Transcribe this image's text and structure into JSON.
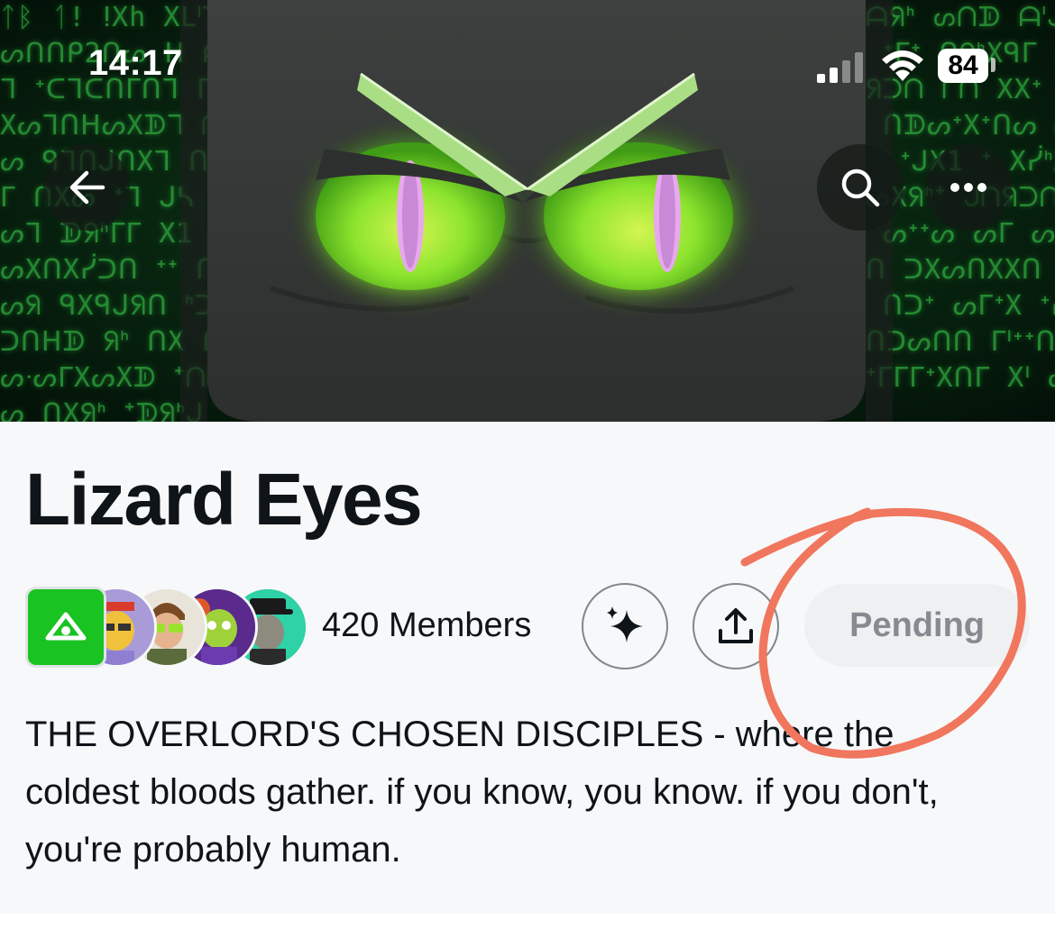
{
  "status_bar": {
    "time": "14:17",
    "battery": "84",
    "icons": [
      "signal-icon",
      "wifi-icon",
      "battery-icon"
    ]
  },
  "header": {
    "icons": [
      "back-arrow-icon",
      "search-icon",
      "more-icon"
    ]
  },
  "community": {
    "name": "Lizard Eyes",
    "members_label": "420 Members",
    "join_status": "Pending",
    "description": "THE OVERLORD'S CHOSEN DISCIPLES - where the coldest bloods gather. if you know, you know. if you don't, you're probably human.",
    "avatar_icons": [
      "eye-logo-icon"
    ]
  },
  "actions": {
    "icons": [
      "sparkle-icon",
      "share-icon"
    ]
  },
  "colors": {
    "accent_green": "#19c321",
    "annotation": "#f0765d",
    "eye_green": "#7be82b",
    "pending_text": "#858b90"
  }
}
